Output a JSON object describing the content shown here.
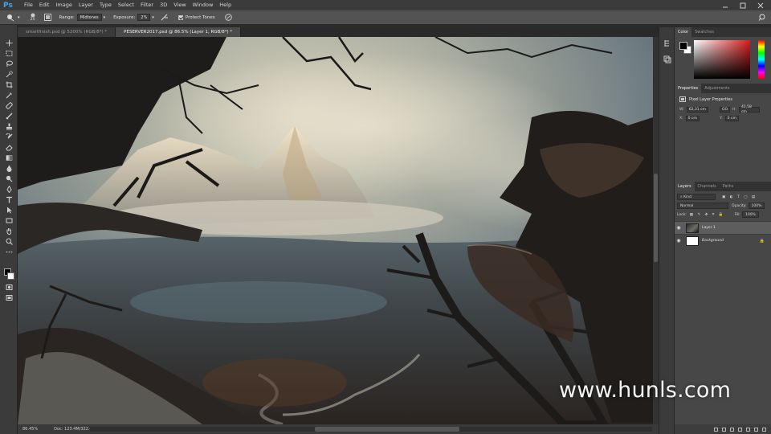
{
  "app": {
    "logo": "Ps"
  },
  "menu": [
    "File",
    "Edit",
    "Image",
    "Layer",
    "Type",
    "Select",
    "Filter",
    "3D",
    "View",
    "Window",
    "Help"
  ],
  "options": {
    "brush_size": "24",
    "range_label": "Range:",
    "range_value": "Midtones",
    "exposure_label": "Exposure:",
    "exposure_value": "2%",
    "protect_tones": "Protect Tones"
  },
  "tabs": [
    {
      "label": "smartfinish.psd @ 5200% (RGB/8*) *"
    },
    {
      "label": "PESERVER2017.psd @ 86.5% (Layer 1, RGB/8*) *"
    }
  ],
  "status": {
    "zoom": "86.45%",
    "doc": "Doc: 123.4M/322.4M"
  },
  "panels": {
    "color_tabs": [
      "Color",
      "Swatches"
    ],
    "properties_tabs": [
      "Properties",
      "Adjustments"
    ],
    "properties_title": "Pixel Layer Properties",
    "props": {
      "w": "62,31 cm",
      "h": "41,58 cm",
      "x": "0 cm",
      "y": "0 cm",
      "w_label": "W:",
      "h_label": "H:",
      "x_label": "X:",
      "y_label": "Y:",
      "link_label": "GO"
    },
    "layers_tabs": [
      "Layers",
      "Channels",
      "Paths"
    ],
    "kind": "Kind",
    "blend": "Normal",
    "opacity_label": "Opacity:",
    "opacity": "100%",
    "lock_label": "Lock:",
    "fill_label": "Fill:",
    "fill": "100%",
    "layers": [
      {
        "name": "Layer 1",
        "active": true
      },
      {
        "name": "Background",
        "active": false
      }
    ]
  },
  "watermark": "www.hunls.com"
}
